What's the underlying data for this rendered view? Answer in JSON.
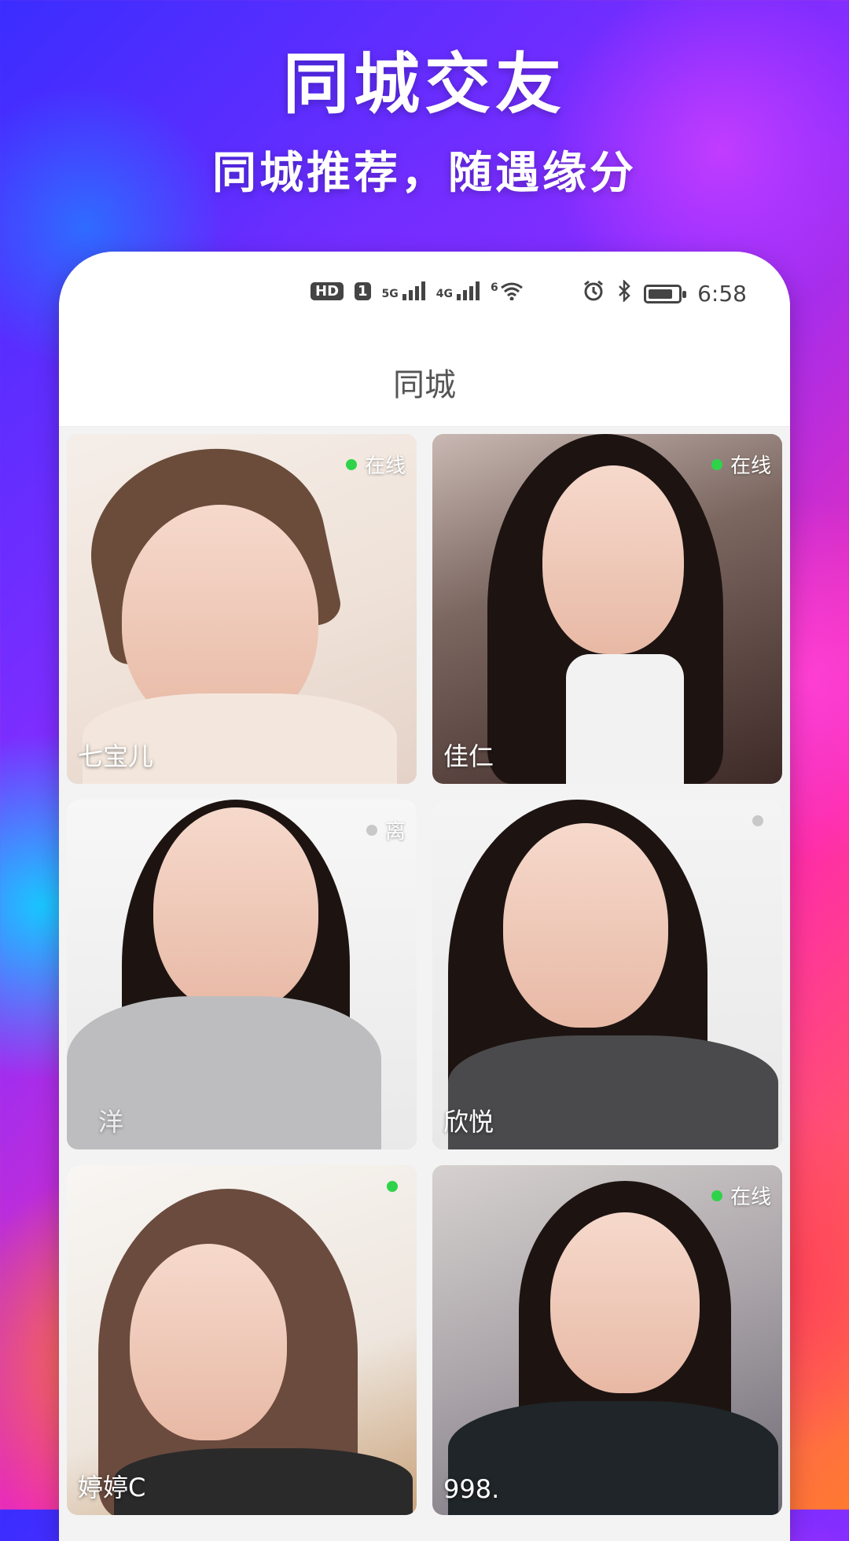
{
  "hero": {
    "title": "同城交友",
    "subtitle": "同城推荐，随遇缘分"
  },
  "statusbar": {
    "left_icons": [
      "hd-icon",
      "sim-1-icon",
      "signal-5g-icon",
      "signal-4g-icon",
      "wifi-6-icon"
    ],
    "hd_label": "HD",
    "sim_label": "1",
    "net1_label": "5G",
    "net2_label": "4G",
    "wifi_label": "6",
    "right_icons": [
      "alarm-icon",
      "bluetooth-icon",
      "battery-icon"
    ],
    "time": "6:58"
  },
  "nav": {
    "title": "同城"
  },
  "cards": [
    {
      "name": "七宝儿",
      "status_label": "在线",
      "status_color": "#2fd34a"
    },
    {
      "name": "佳仁",
      "status_label": "在线",
      "status_color": "#2fd34a"
    },
    {
      "name": "洋",
      "status_label": "离",
      "status_color": "#c8c8c8"
    },
    {
      "name": "欣悦",
      "status_label": "",
      "status_color": "#c8c8c8"
    },
    {
      "name": "婷婷C",
      "status_label": "",
      "status_color": "#2fd34a"
    },
    {
      "name": "998.",
      "status_label": "在线",
      "status_color": "#2fd34a"
    }
  ]
}
